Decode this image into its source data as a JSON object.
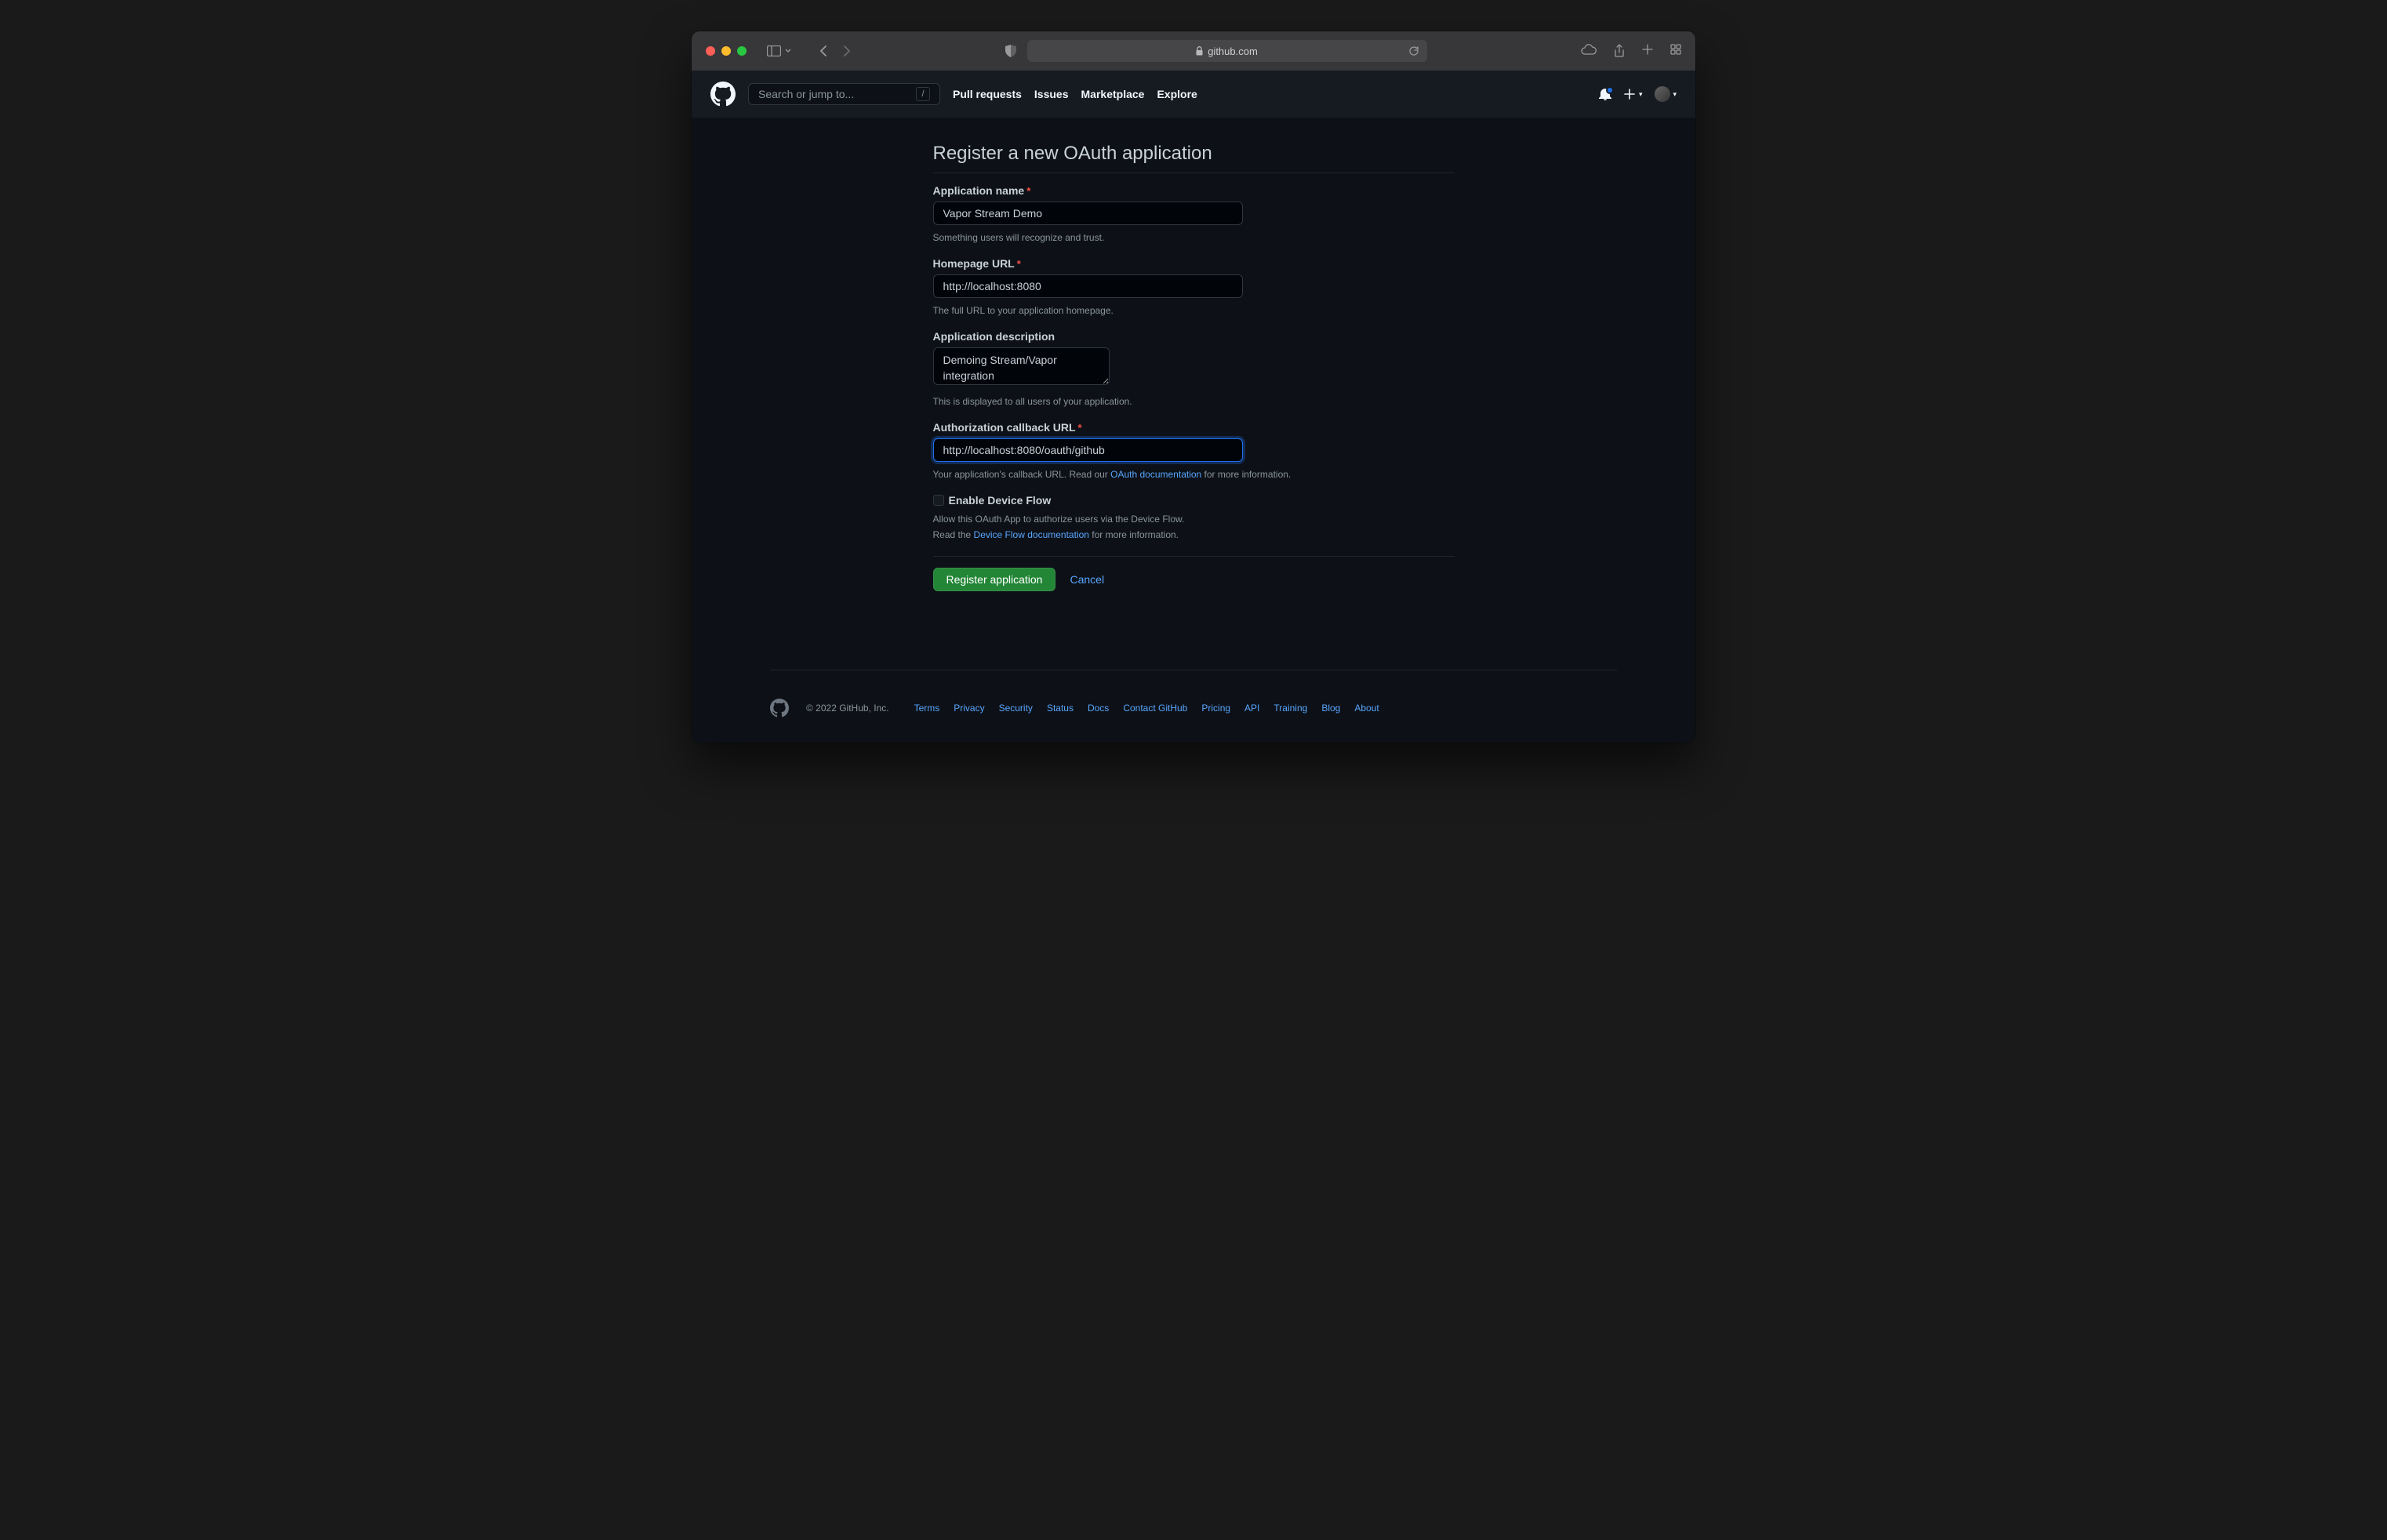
{
  "browser": {
    "url_display": "github.com"
  },
  "header": {
    "search_placeholder": "Search or jump to...",
    "search_key": "/",
    "nav": {
      "pull_requests": "Pull requests",
      "issues": "Issues",
      "marketplace": "Marketplace",
      "explore": "Explore"
    }
  },
  "page": {
    "title": "Register a new OAuth application"
  },
  "form": {
    "app_name": {
      "label": "Application name",
      "value": "Vapor Stream Demo",
      "hint": "Something users will recognize and trust."
    },
    "homepage": {
      "label": "Homepage URL",
      "value": "http://localhost:8080",
      "hint": "The full URL to your application homepage."
    },
    "description": {
      "label": "Application description",
      "value": "Demoing Stream/Vapor integration",
      "hint": "This is displayed to all users of your application."
    },
    "callback": {
      "label": "Authorization callback URL",
      "value": "http://localhost:8080/oauth/github",
      "hint_pre": "Your application's callback URL. Read our ",
      "hint_link": "OAuth documentation",
      "hint_post": " for more information."
    },
    "device_flow": {
      "label": "Enable Device Flow",
      "hint1": "Allow this OAuth App to authorize users via the Device Flow.",
      "hint2_pre": "Read the ",
      "hint2_link": "Device Flow documentation",
      "hint2_post": " for more information."
    },
    "submit": "Register application",
    "cancel": "Cancel"
  },
  "footer": {
    "copyright": "© 2022 GitHub, Inc.",
    "links": {
      "terms": "Terms",
      "privacy": "Privacy",
      "security": "Security",
      "status": "Status",
      "docs": "Docs",
      "contact": "Contact GitHub",
      "pricing": "Pricing",
      "api": "API",
      "training": "Training",
      "blog": "Blog",
      "about": "About"
    }
  }
}
